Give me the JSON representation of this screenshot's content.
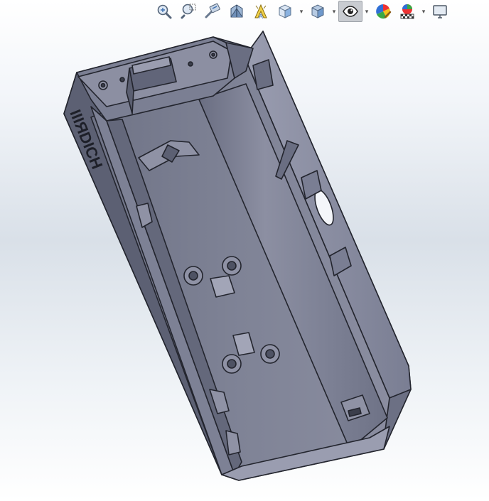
{
  "toolbar": {
    "buttons": [
      {
        "icon": "zoom-to-fit-icon"
      },
      {
        "icon": "zoom-to-area-icon"
      },
      {
        "icon": "previous-view-icon"
      },
      {
        "icon": "section-view-icon"
      },
      {
        "icon": "dynamic-annotation-view-icon"
      },
      {
        "icon": "view-orientation-icon",
        "has_dropdown": true
      },
      {
        "icon": "display-style-icon",
        "has_dropdown": true
      },
      {
        "icon": "hide-show-items-icon",
        "has_dropdown": true,
        "active": true
      },
      {
        "icon": "edit-appearance-icon"
      },
      {
        "icon": "apply-scene-icon",
        "has_dropdown": true
      },
      {
        "icon": "view-settings-icon"
      }
    ]
  },
  "model": {
    "embossed_text": "IIIЯDICH",
    "colors": {
      "body": "#7a7e93",
      "body_dark": "#5c6073",
      "body_light": "#9a9db0",
      "edge": "#23252e"
    }
  }
}
